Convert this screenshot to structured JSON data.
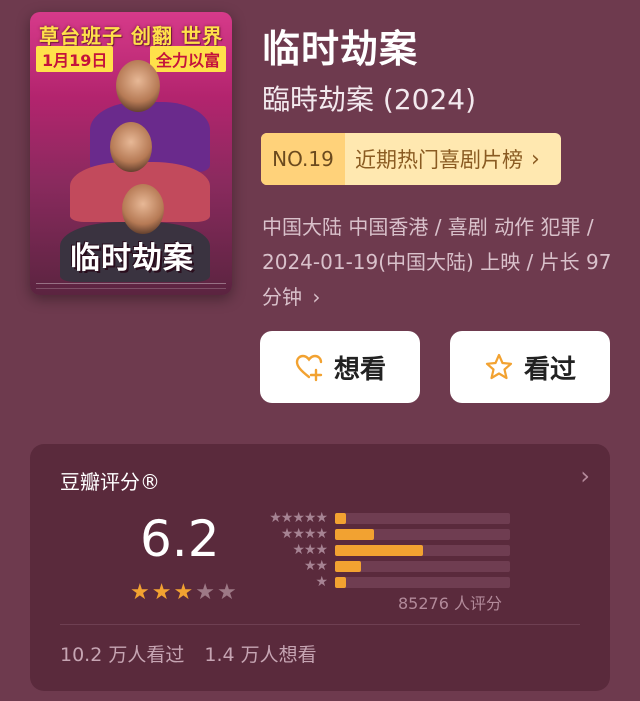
{
  "poster": {
    "banner": "草台班子 创翻 世界",
    "date_tag": "1月19日",
    "slogan_tag": "全力以富",
    "title": "临时劫案"
  },
  "movie": {
    "title": "临时劫案",
    "original_title": "臨時劫案 (2024)",
    "rank_no": "NO.19",
    "rank_label": "近期热门喜剧片榜",
    "meta_line": "中国大陆 中国香港 / 喜剧 动作 犯罪 / 2024-01-19(中国大陆) 上映 / 片长 97 分钟"
  },
  "actions": {
    "want_label": "想看",
    "watched_label": "看过"
  },
  "rating": {
    "title": "豆瓣评分®",
    "score": "6.2",
    "score_stars": 3,
    "distribution": [
      {
        "stars": 5,
        "fraction": 0.06
      },
      {
        "stars": 4,
        "fraction": 0.22
      },
      {
        "stars": 3,
        "fraction": 0.5
      },
      {
        "stars": 2,
        "fraction": 0.15
      },
      {
        "stars": 1,
        "fraction": 0.06
      }
    ],
    "votes": "85276 人评分",
    "watched_count": "10.2 万人看过",
    "want_count": "1.4 万人想看"
  },
  "colors": {
    "background": "#6e3a4e",
    "accent": "#f2a231",
    "card": "#5a2a3c"
  }
}
